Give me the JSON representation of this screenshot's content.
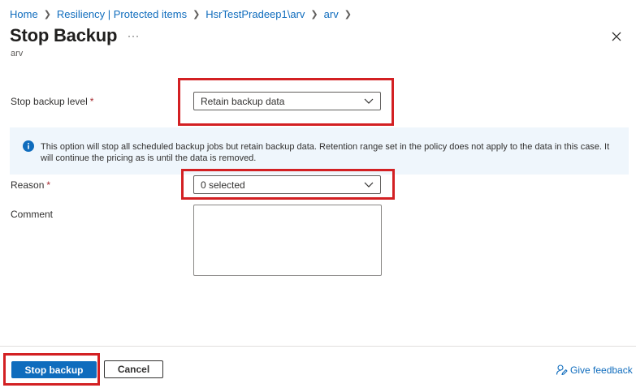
{
  "breadcrumb": {
    "items": [
      "Home",
      "Resiliency | Protected items",
      "HsrTestPradeep1\\arv",
      "arv"
    ]
  },
  "header": {
    "title": "Stop Backup",
    "more": "···",
    "subtitle": "arv"
  },
  "form": {
    "stop_level": {
      "label": "Stop backup level",
      "required_mark": "*",
      "value": "Retain backup data"
    },
    "info_message": "This option will stop all scheduled backup jobs but retain backup data. Retention range set in the policy does not apply to the data in this case. It will continue the pricing as is until the data is removed.",
    "reason": {
      "label": "Reason",
      "required_mark": "*",
      "value": "0 selected"
    },
    "comment": {
      "label": "Comment",
      "value": ""
    }
  },
  "footer": {
    "primary_label": "Stop backup",
    "cancel_label": "Cancel",
    "feedback_label": "Give feedback"
  },
  "colors": {
    "accent": "#0f6cbd",
    "highlight": "#d32023",
    "info_background": "#eff6fc"
  }
}
